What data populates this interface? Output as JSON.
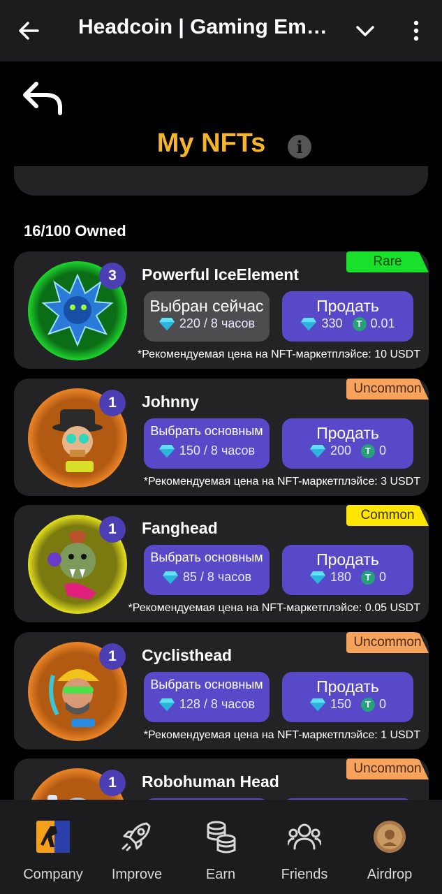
{
  "topbar": {
    "title": "Headcoin | Gaming Em…"
  },
  "page": {
    "title": "My NFTs",
    "info_symbol": "i",
    "owned": "16/100 Owned"
  },
  "cards": [
    {
      "name": "Powerful IceElement",
      "rarity": "Rare",
      "level": "3",
      "select_label": "Выбран сейчас",
      "select_value": "220 / 8 часов",
      "sell_label": "Продать",
      "sell_gems": "330",
      "sell_usdt": "0.01",
      "hint": "*Рекомендуемая цена на NFT-маркетплэйсе: 10 USDT"
    },
    {
      "name": "Johnny",
      "rarity": "Uncommon",
      "level": "1",
      "select_label": "Выбрать основным",
      "select_value": "150 / 8 часов",
      "sell_label": "Продать",
      "sell_gems": "200",
      "sell_usdt": "0",
      "hint": "*Рекомендуемая цена на NFT-маркетплэйсе: 3 USDT"
    },
    {
      "name": "Fanghead",
      "rarity": "Common",
      "level": "1",
      "select_label": "Выбрать основным",
      "select_value": "85 / 8 часов",
      "sell_label": "Продать",
      "sell_gems": "180",
      "sell_usdt": "0",
      "hint": "*Рекомендуемая цена на NFT-маркетплэйсе: 0.05 USDT"
    },
    {
      "name": "Cyclisthead",
      "rarity": "Uncommon",
      "level": "1",
      "select_label": "Выбрать основным",
      "select_value": "128 / 8 часов",
      "sell_label": "Продать",
      "sell_gems": "150",
      "sell_usdt": "0",
      "hint": "*Рекомендуемая цена на NFT-маркетплэйсе: 1 USDT"
    },
    {
      "name": "Robohuman Head",
      "rarity": "Uncommon",
      "level": "1"
    }
  ],
  "usdt_symbol": "T",
  "tabs": [
    {
      "label": "Company",
      "icon": "company-icon"
    },
    {
      "label": "Improve",
      "icon": "rocket-icon"
    },
    {
      "label": "Earn",
      "icon": "coins-stack-icon"
    },
    {
      "label": "Friends",
      "icon": "friends-icon"
    },
    {
      "label": "Airdrop",
      "icon": "coin-icon"
    }
  ],
  "colors": {
    "accent": "#f4b52a",
    "button": "#5849c9",
    "rare": "#19e02a",
    "uncommon": "#f7a35c",
    "common": "#ffe600"
  }
}
